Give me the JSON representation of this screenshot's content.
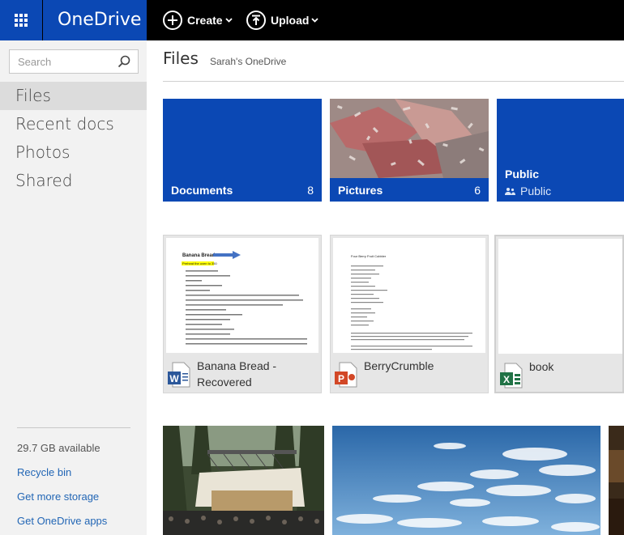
{
  "app": {
    "brand": "OneDrive"
  },
  "toolbar": {
    "create_label": "Create",
    "upload_label": "Upload"
  },
  "search": {
    "placeholder": "Search"
  },
  "nav": [
    {
      "label": "Files",
      "active": true
    },
    {
      "label": "Recent docs"
    },
    {
      "label": "Photos"
    },
    {
      "label": "Shared"
    }
  ],
  "footer": {
    "storage": "29.7 GB available",
    "recycle": "Recycle bin",
    "more_storage": "Get more storage",
    "apps": "Get OneDrive apps"
  },
  "main": {
    "title": "Files",
    "breadcrumb": "Sarah's OneDrive"
  },
  "folders": [
    {
      "name": "Documents",
      "count": "8"
    },
    {
      "name": "Pictures",
      "count": "6"
    },
    {
      "name": "Public",
      "sharing": "Public"
    }
  ],
  "docs": [
    {
      "name": "Banana Bread - Recovered",
      "app_icon": "word-icon"
    },
    {
      "name": "BerryCrumble",
      "app_icon": "powerpoint-icon"
    },
    {
      "name": "book",
      "app_icon": "excel-icon"
    }
  ],
  "doc_preview": {
    "banana_title": "Banana Bread",
    "banana_highlight": "Preheat the oven to 350",
    "berry_title": "Four Berry Fruit Cobbler"
  },
  "colors": {
    "brand_blue": "#0b48b4",
    "topbar": "#000000",
    "link": "#2266b5"
  }
}
